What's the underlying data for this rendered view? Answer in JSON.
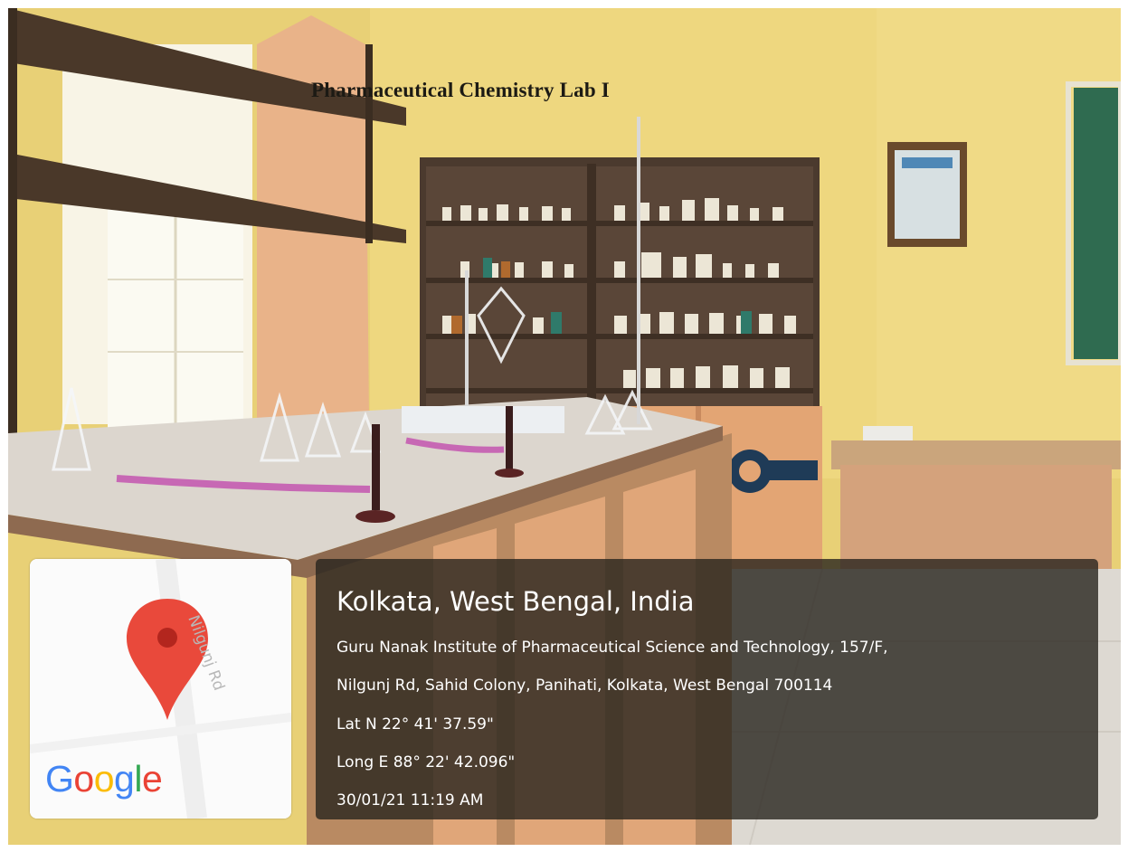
{
  "sign": {
    "text": "Pharmaceutical Chemistry Lab I"
  },
  "map_card": {
    "road_label": "Nilgunj Rd",
    "logo": "Google",
    "pin": "map-pin-icon",
    "colors": {
      "pin": "#e9493b",
      "blue": "#4285f4",
      "red": "#ea4335",
      "yellow": "#fbbc05",
      "green": "#34a853"
    }
  },
  "location": {
    "city": "Kolkata, West Bengal, India",
    "address_line1": "Guru Nanak Institute of Pharmaceutical Science and Technology, 157/F,",
    "address_line2": "Nilgunj Rd, Sahid Colony, Panihati, Kolkata, West Bengal 700114",
    "latitude": "Lat N 22° 41' 37.59\"",
    "longitude": "Long E 88° 22' 42.096\"",
    "timestamp": "30/01/21 11:19 AM"
  }
}
